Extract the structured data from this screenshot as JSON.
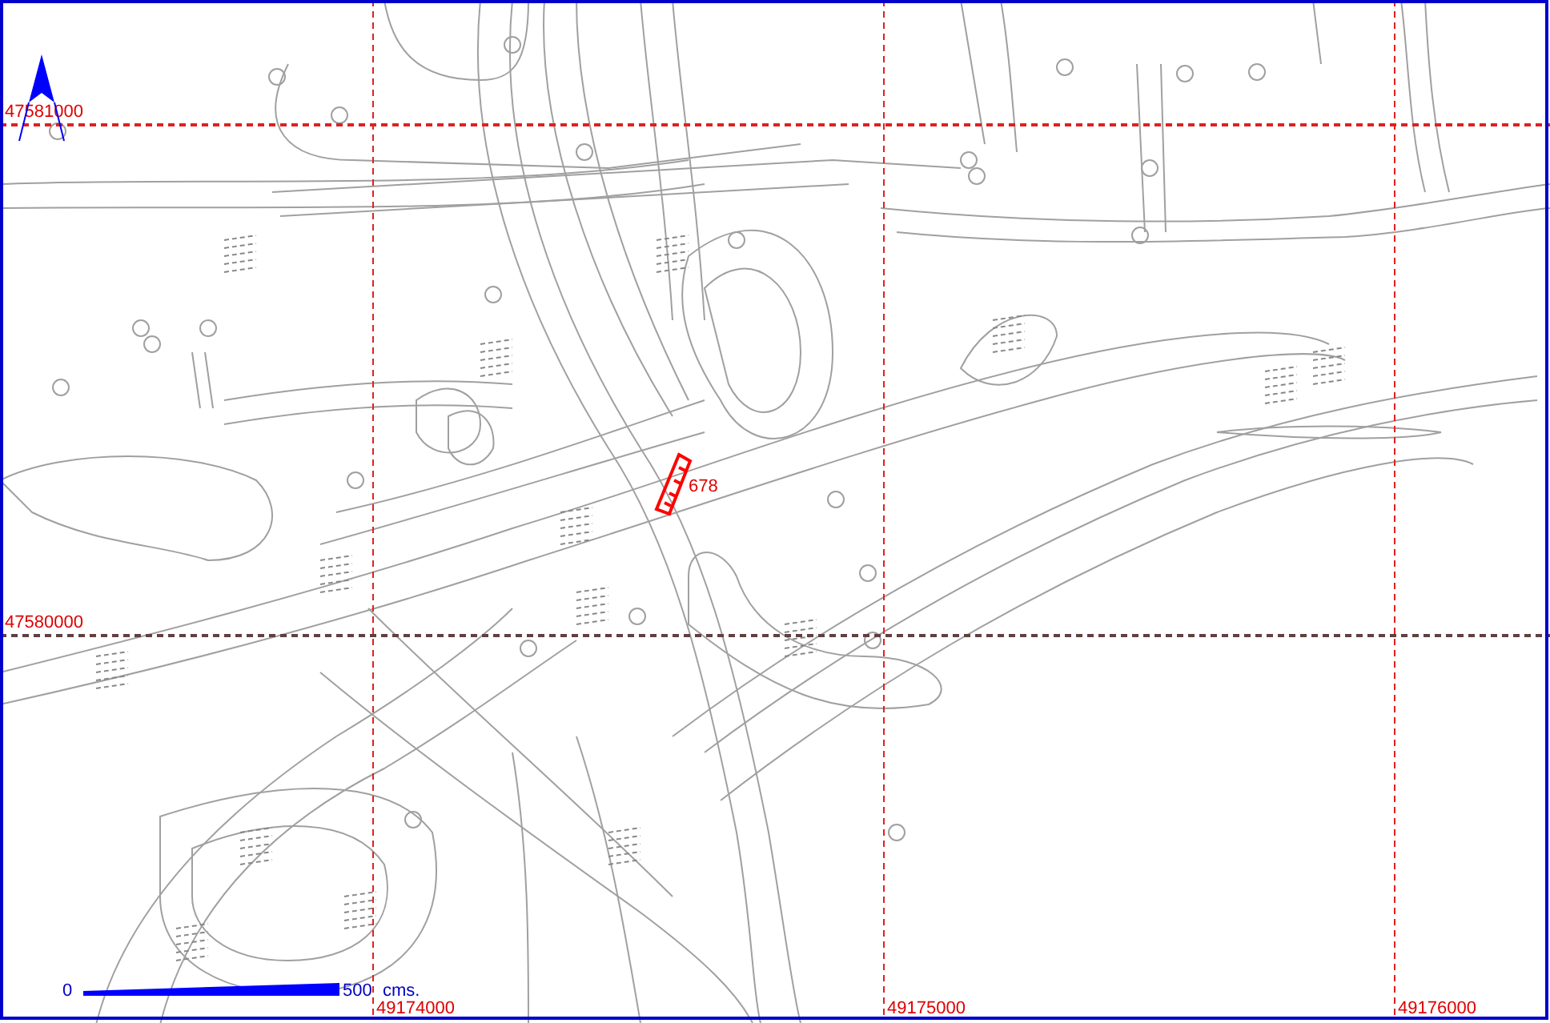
{
  "grid": {
    "eastings": [
      {
        "label": "49174000"
      },
      {
        "label": "49175000"
      },
      {
        "label": "49176000"
      }
    ],
    "northings": [
      {
        "label": "47581000",
        "color": "#e02020"
      },
      {
        "label": "47580000",
        "color": "#604040"
      }
    ]
  },
  "feature": {
    "label": "678",
    "selected": true
  },
  "scale_bar": {
    "start": "0",
    "end": "500",
    "unit": "cms."
  }
}
